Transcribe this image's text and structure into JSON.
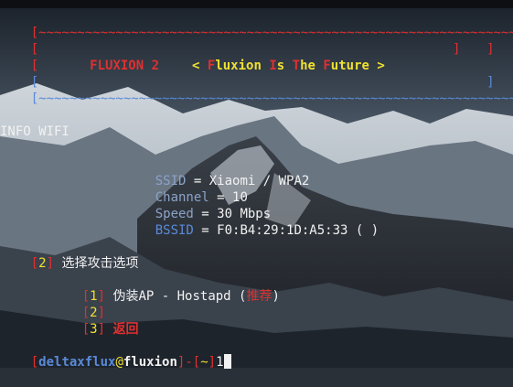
{
  "banner": {
    "border_top": "[~~~~~~~~~~~~~~~~~~~~~~~~~~~~~~~~~~~~~~~~~~~~~~~~~~~~~~~~~~~~~~]",
    "border_bottom": "[~~~~~~~~~~~~~~~~~~~~~~~~~~~~~~~~~~~~~~~~~~~~~~~~~~~~~~~~~~~~~~]",
    "bracket_left": "[",
    "bracket_right": "]",
    "app_name": "FLUXION 2",
    "tagline_open": "< ",
    "tag_f": "F",
    "tag_luxion": "luxion ",
    "tag_i": "I",
    "tag_s": "s ",
    "tag_t": "T",
    "tag_he": "he ",
    "tag_f2": "F",
    "tag_uture": "uture",
    "tagline_close": " >"
  },
  "info": {
    "heading": "INFO WIFI",
    "ssid_key": "SSID",
    "ssid_val": " = Xiaomi / WPA2",
    "channel_key": "Channel",
    "channel_val": " = 10",
    "speed_key": "Speed",
    "speed_val": " = 30 Mbps",
    "bssid_key": "BSSID",
    "bssid_val": " = F0:B4:29:1D:A5:33 ( )"
  },
  "menu": {
    "prompt_open": "[",
    "prompt_num": "2",
    "prompt_close": "]",
    "prompt_text": " 选择攻击选项",
    "options": [
      {
        "num": "1",
        "label": " 伪装AP - Hostapd (",
        "note": "推荐",
        "end": ")"
      },
      {
        "num": "2",
        "label": ""
      },
      {
        "num": "3",
        "label": " 返回"
      }
    ]
  },
  "shell": {
    "bracket_open": "[",
    "user": "deltaxflux",
    "at": "@",
    "host": "fluxion",
    "sep": "]-[",
    "cwd": "~",
    "bracket_close": "]",
    "input": "1"
  },
  "colors": {
    "red": "#e03030",
    "yellow": "#f0e030",
    "blue": "#5a8ad8",
    "background": "#2a3038"
  }
}
